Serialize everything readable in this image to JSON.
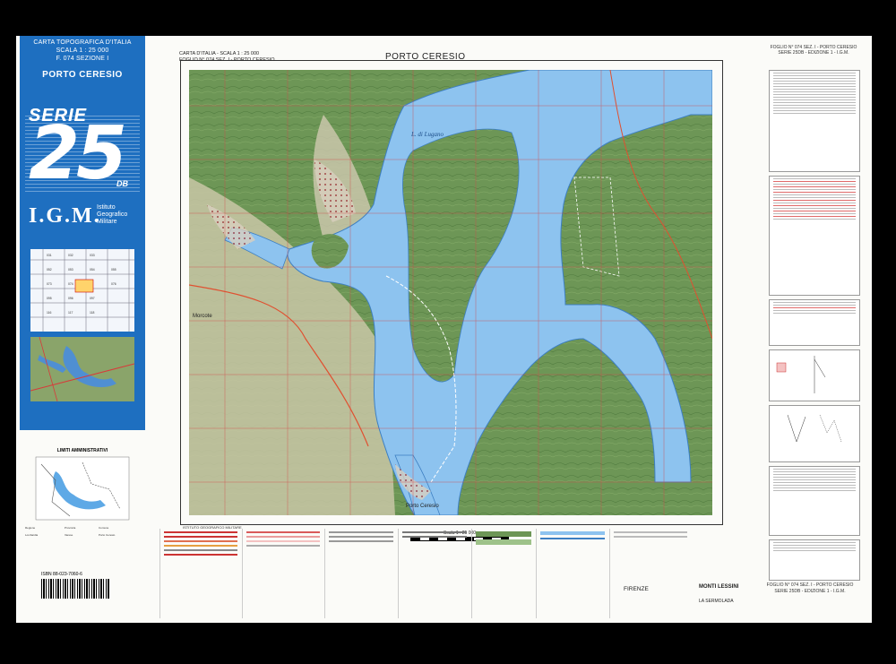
{
  "cover": {
    "line1": "CARTA TOPOGRAFICA D'ITALIA",
    "line2": "SCALA 1 : 25 000",
    "line3": "F. 074 SEZIONE I",
    "sheet_name": "PORTO CERESIO",
    "serie": "SERIE",
    "number": "25",
    "edition": "DB",
    "publisher_logo": "I.G.M.",
    "publisher_name": "Istituto Geografico Militare"
  },
  "header": {
    "left_line1": "CARTA D'ITALIA - SCALA 1 : 25 000",
    "left_line2": "FOGLIO N° 074 SEZ. I - PORTO CERESIO",
    "title": "PORTO CERESIO"
  },
  "map_labels": {
    "lake": "L. di Lugano",
    "town_south": "Porto Ceresio",
    "town_west": "Morcote"
  },
  "limits": {
    "title": "LIMITI AMMINISTRATIVI"
  },
  "isbn": "ISBN 88-023-7060-6",
  "right_col": {
    "top_label": "FOGLIO N° 074 SEZ. I - PORTO CERESIO",
    "top_sub": "SERIE 25DB - EDIZIONE 1 - I.G.M.",
    "bottom_label": "FOGLIO N° 074 SEZ. I - PORTO CERESIO",
    "bottom_sub": "SERIE 25DB - EDIZIONE 1 - I.G.M."
  },
  "legend": {
    "institute": "ISTITUTO GEOGRAFICO MILITARE",
    "scale_text": "Scala 1 : 25 000",
    "firenze": "FIRENZE",
    "monti": "MONTI LESSINI",
    "mermo": "LA SERMOLADA"
  },
  "colors": {
    "cover_blue": "#1e6fc0",
    "lake_blue": "#8dc3ef",
    "forest_green": "#6f9758",
    "grid_red": "#d24b4b"
  }
}
